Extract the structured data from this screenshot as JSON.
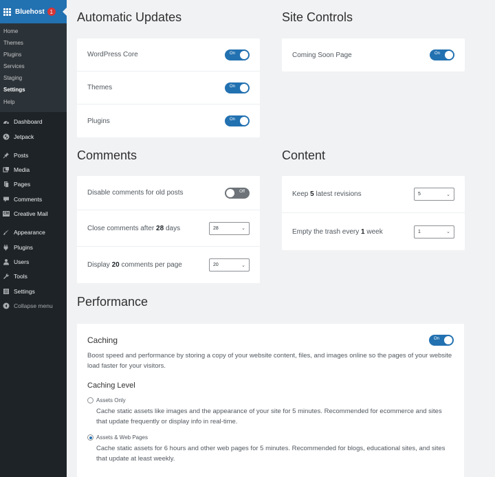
{
  "sidebar": {
    "brand_label": "Bluehost",
    "brand_badge": "1",
    "submenu": [
      "Home",
      "Themes",
      "Plugins",
      "Services",
      "Staging",
      "Settings",
      "Help"
    ],
    "active_submenu": "Settings",
    "menu": [
      {
        "label": "Dashboard",
        "icon": "dashboard-icon"
      },
      {
        "label": "Jetpack",
        "icon": "jetpack-icon"
      },
      {
        "label": "Posts",
        "icon": "pin-icon"
      },
      {
        "label": "Media",
        "icon": "media-icon"
      },
      {
        "label": "Pages",
        "icon": "pages-icon"
      },
      {
        "label": "Comments",
        "icon": "comment-icon"
      },
      {
        "label": "Creative Mail",
        "icon": "creative-mail-icon",
        "icon_text": "CM"
      },
      {
        "label": "Appearance",
        "icon": "brush-icon"
      },
      {
        "label": "Plugins",
        "icon": "plugin-icon"
      },
      {
        "label": "Users",
        "icon": "users-icon"
      },
      {
        "label": "Tools",
        "icon": "wrench-icon"
      },
      {
        "label": "Settings",
        "icon": "settings-icon"
      },
      {
        "label": "Collapse menu",
        "icon": "collapse-icon"
      }
    ]
  },
  "automatic_updates": {
    "title": "Automatic Updates",
    "rows": [
      {
        "label": "WordPress Core",
        "toggle": "On"
      },
      {
        "label": "Themes",
        "toggle": "On"
      },
      {
        "label": "Plugins",
        "toggle": "On"
      }
    ]
  },
  "site_controls": {
    "title": "Site Controls",
    "rows": [
      {
        "label": "Coming Soon Page",
        "toggle": "On"
      }
    ]
  },
  "comments": {
    "title": "Comments",
    "disable_old": {
      "label": "Disable comments for old posts",
      "toggle": "Off"
    },
    "close_after": {
      "pre": "Close comments after ",
      "value": "28",
      "post": " days",
      "select": "28"
    },
    "per_page": {
      "pre": "Display ",
      "value": "20",
      "post": " comments per page",
      "select": "20"
    }
  },
  "content": {
    "title": "Content",
    "revisions": {
      "pre": "Keep ",
      "value": "5",
      "post": " latest revisions",
      "select": "5"
    },
    "trash": {
      "pre": "Empty the trash every ",
      "value": "1",
      "post": " week",
      "select": "1"
    }
  },
  "performance": {
    "title": "Performance",
    "caching_title": "Caching",
    "caching_toggle": "On",
    "caching_desc": "Boost speed and performance by storing a copy of your website content, files, and images online so the pages of your website load faster for your visitors.",
    "level_title": "Caching Level",
    "options": [
      {
        "label": "Assets Only",
        "checked": false,
        "desc": "Cache static assets like images and the appearance of your site for 5 minutes. Recommended for ecommerce and sites that update frequently or display info in real-time."
      },
      {
        "label": "Assets & Web Pages",
        "checked": true,
        "desc": "Cache static assets for 6 hours and other web pages for 5 minutes. Recommended for blogs, educational sites, and sites that update at least weekly."
      }
    ]
  },
  "colors": {
    "accent": "#2271b1",
    "sidebar_bg": "#1d2327",
    "page_bg": "#f1f2f3"
  }
}
